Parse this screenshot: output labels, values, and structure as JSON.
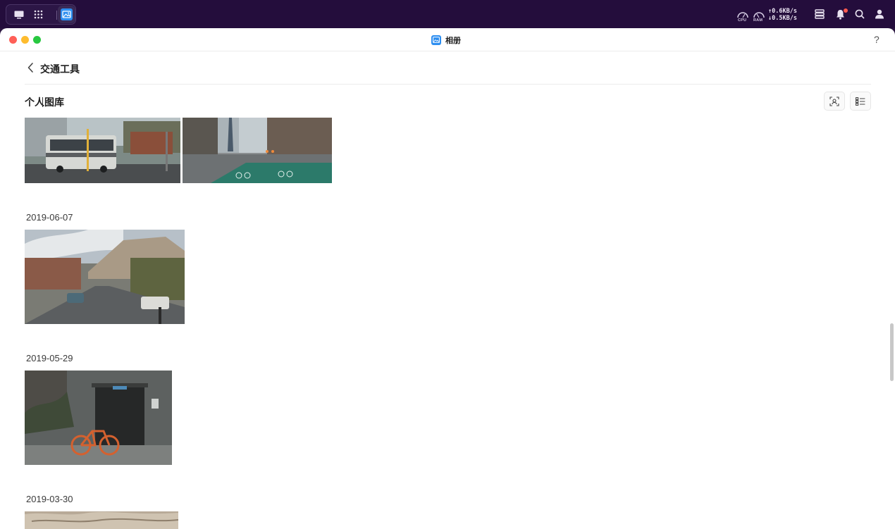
{
  "taskbar": {
    "launcher_icons": [
      "desktop-icon",
      "app-grid-icon",
      "photos-app-icon"
    ],
    "gauges": {
      "cpu_label": "CPU",
      "ram_label": "RAM"
    },
    "network": {
      "upload": "0.6KB/s",
      "download": "0.5KB/s"
    },
    "tray_icons": [
      "task-manager-icon",
      "bell-icon",
      "search-icon",
      "user-icon"
    ]
  },
  "window": {
    "title": "相册",
    "help_label": "?",
    "album_title": "交通工具",
    "section_title": "个人图库"
  },
  "groups": [
    {
      "date": "",
      "photos": [
        "bus-at-crossing",
        "street-bike-lane"
      ]
    },
    {
      "date": "2019-06-07",
      "photos": [
        "mountain-town-street"
      ]
    },
    {
      "date": "2019-05-29",
      "photos": [
        "orange-bicycle-doorway"
      ]
    },
    {
      "date": "2019-03-30",
      "photos": [
        "snowy-texture"
      ]
    }
  ],
  "colors": {
    "taskbar": "#240d3c",
    "accent": "#2d8ef0",
    "close": "#ff5f57",
    "minimize": "#febc2e",
    "zoom": "#28c840"
  }
}
